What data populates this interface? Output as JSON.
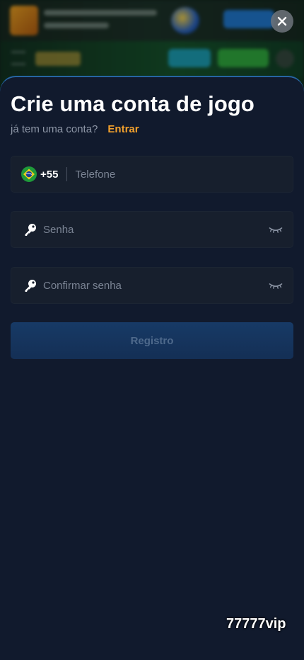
{
  "modal": {
    "title": "Crie uma conta de jogo",
    "have_account_text": "já tem uma conta?",
    "login_link": "Entrar"
  },
  "phone": {
    "flag_icon": "brazil-flag-icon",
    "country_code": "+55",
    "placeholder": "Telefone",
    "value": ""
  },
  "password": {
    "icon": "key-icon",
    "placeholder": "Senha",
    "value": "",
    "visibility_icon": "eye-closed-icon"
  },
  "confirm_password": {
    "icon": "key-icon",
    "placeholder": "Confirmar senha",
    "value": "",
    "visibility_icon": "eye-closed-icon"
  },
  "register_button": {
    "label": "Registro",
    "enabled": false
  },
  "close_icon": "close-icon",
  "watermark": "77777vip",
  "colors": {
    "sheet_background": "#111a2d",
    "accent_link": "#f3a12d",
    "field_background": "#171f2d",
    "button_background": "#173a66",
    "button_text": "#4f6a8c"
  }
}
